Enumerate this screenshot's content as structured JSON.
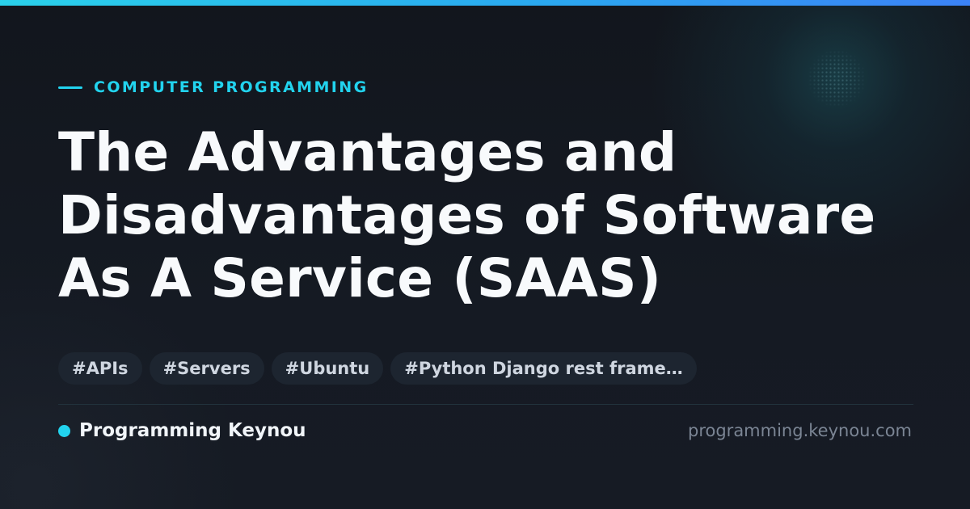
{
  "category": "COMPUTER PROGRAMMING",
  "title_lines": [
    "The Advantages and",
    "Disadvantages of Software",
    "As A Service (SAAS)"
  ],
  "tags": [
    "#APIs",
    "#Servers",
    "#Ubuntu",
    "#Python Django rest frame..."
  ],
  "footer": {
    "site_name": "Programming Keynou",
    "domain": "programming.keynou.com"
  },
  "colors": {
    "accent": "#22d3ee",
    "background": "#12161e",
    "title": "#f8fafc",
    "tag_background": "#1d2530"
  },
  "icons": {
    "category_marker": "accent-line-icon",
    "brand_marker": "dot-icon"
  }
}
